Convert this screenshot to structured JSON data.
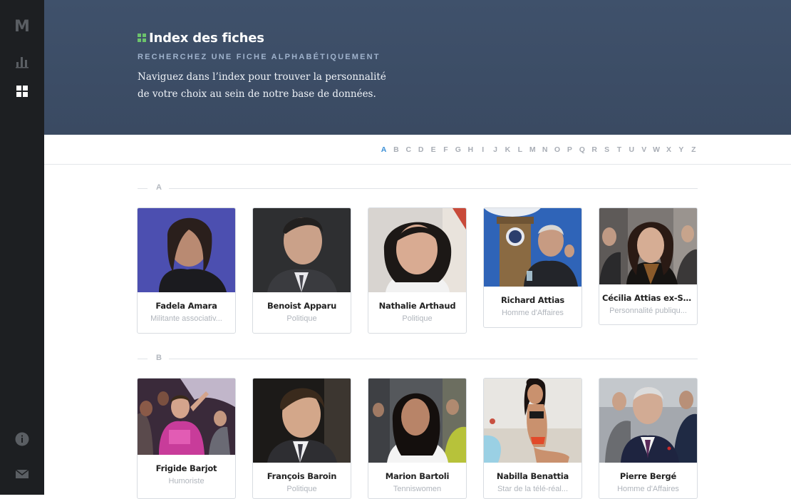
{
  "sidebar": {
    "logo": "M",
    "icons": [
      "stats-icon",
      "grid-icon",
      "info-icon",
      "mail-icon"
    ]
  },
  "header": {
    "title": "Index des fiches",
    "subtitle": "RECHERCHEZ UNE FICHE ALPHABÉTIQUEMENT",
    "description": "Naviguez dans l’index pour trouver la personnalité de votre choix au sein de notre base de données."
  },
  "alphabet": {
    "active": "A",
    "letters": [
      "A",
      "B",
      "C",
      "D",
      "E",
      "F",
      "G",
      "H",
      "I",
      "J",
      "K",
      "L",
      "M",
      "N",
      "O",
      "P",
      "Q",
      "R",
      "S",
      "T",
      "U",
      "V",
      "W",
      "X",
      "Y",
      "Z"
    ]
  },
  "sections": [
    {
      "letter": "A",
      "people": [
        {
          "name": "Fadela Amara",
          "role": "Militante associativ..."
        },
        {
          "name": "Benoist Apparu",
          "role": "Politique"
        },
        {
          "name": "Nathalie Arthaud",
          "role": "Politique"
        },
        {
          "name": "Richard Attias",
          "role": "Homme d'Affaires"
        },
        {
          "name": "Cécilia Attias ex-Sarkozy",
          "role": "Personnalité publiqu..."
        }
      ]
    },
    {
      "letter": "B",
      "people": [
        {
          "name": "Frigide Barjot",
          "role": "Humoriste"
        },
        {
          "name": "François Baroin",
          "role": "Politique"
        },
        {
          "name": "Marion Bartoli",
          "role": "Tenniswomen"
        },
        {
          "name": "Nabilla Benattia",
          "role": "Star de la télé-réal..."
        },
        {
          "name": "Pierre Bergé",
          "role": "Homme d'Affaires"
        }
      ]
    }
  ],
  "colors": {
    "sidebar_bg": "#1d1f22",
    "header_bg": "#3d4e68",
    "accent": "#3b8fd6",
    "title_icon": "#6cc36c"
  }
}
